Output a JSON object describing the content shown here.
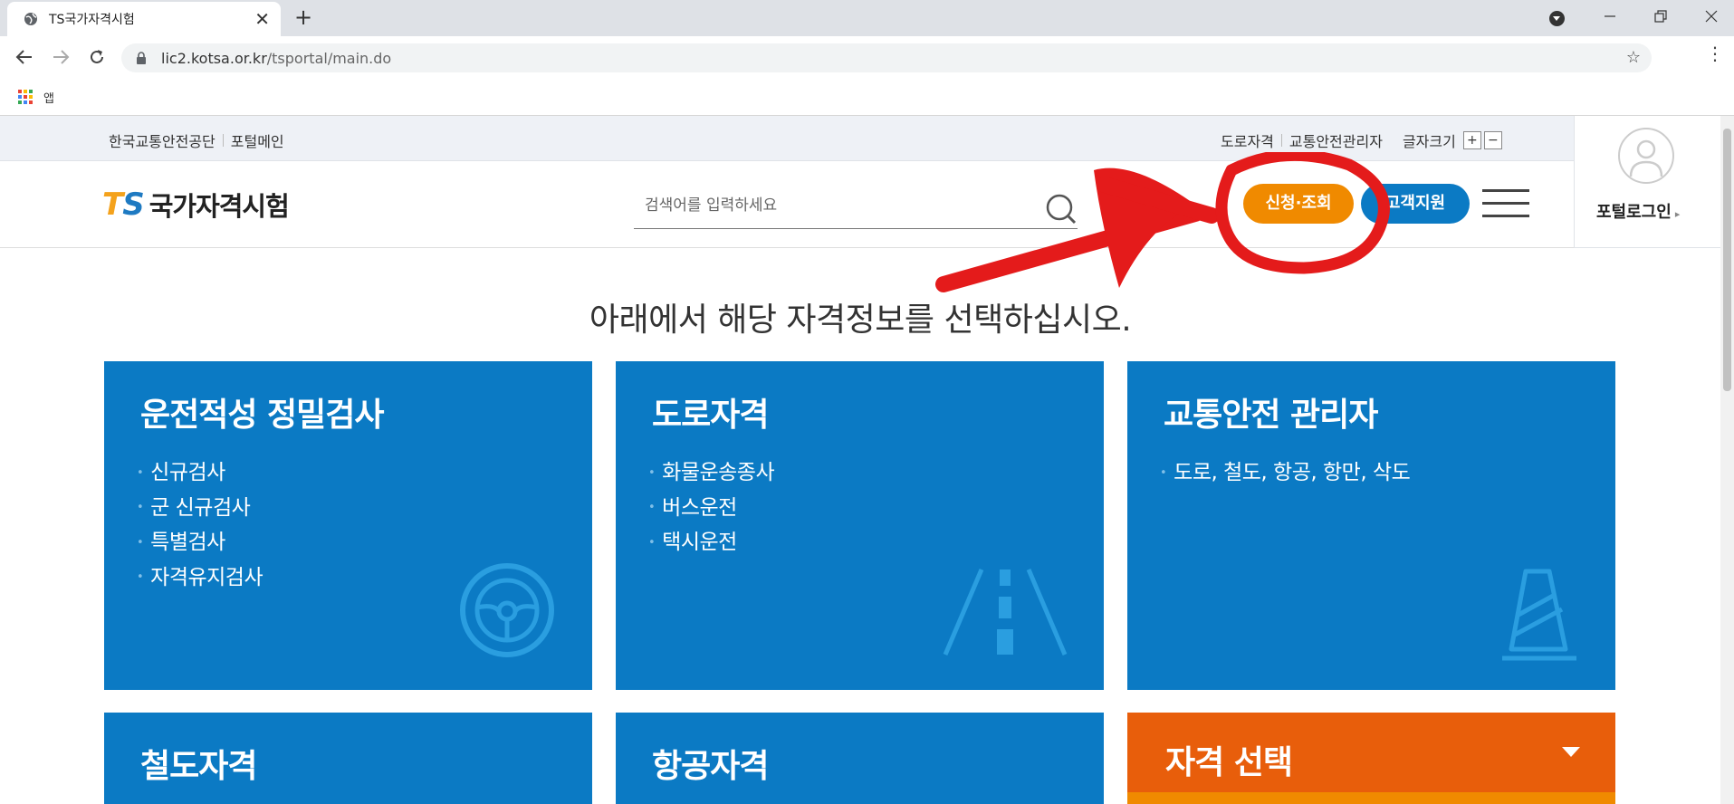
{
  "browser": {
    "tab_title": "TS국가자격시험",
    "tab_close": "✕",
    "new_tab": "+",
    "url_host": "lic2.kotsa.or.kr",
    "url_path": "/tsportal/main.do",
    "bookmarks_apps_label": "앱",
    "apps_colors": [
      "#ea4335",
      "#fbbc05",
      "#34a853",
      "#4285f4",
      "#ea4335",
      "#fbbc05",
      "#34a853",
      "#4285f4",
      "#ea4335"
    ]
  },
  "topbar": {
    "org_link": "한국교통안전공단",
    "portal_main": "포털메인",
    "road_qual": "도로자격",
    "safety_manager": "교통안전관리자",
    "font_size_label": "글자크기",
    "font_plus": "+",
    "font_minus": "−"
  },
  "login": {
    "label": "포털로그인",
    "arrow": "▸"
  },
  "header": {
    "logo_t": "T",
    "logo_s": "S",
    "logo_name": "국가자격시험",
    "search_placeholder": "검색어를 입력하세요",
    "apply_button": "신청·조회",
    "support_button": "고객지원"
  },
  "main": {
    "headline": "아래에서 해당 자격정보를 선택하십시오.",
    "cards": [
      {
        "title": "운전적성 정밀검사",
        "items": [
          "신규검사",
          "군 신규검사",
          "특별검사",
          "자격유지검사"
        ]
      },
      {
        "title": "도로자격",
        "items": [
          "화물운송종사",
          "버스운전",
          "택시운전"
        ]
      },
      {
        "title": "교통안전 관리자",
        "items": [
          "도로, 철도, 항공, 항만, 삭도"
        ]
      },
      {
        "title": "철도자격"
      },
      {
        "title": "항공자격"
      }
    ],
    "select_card": {
      "title": "자격 선택"
    }
  },
  "colors": {
    "primary_blue": "#0b7ac4",
    "orange": "#f08a00",
    "select_orange": "#e85e0b",
    "annotation_red": "#e41b1b"
  }
}
